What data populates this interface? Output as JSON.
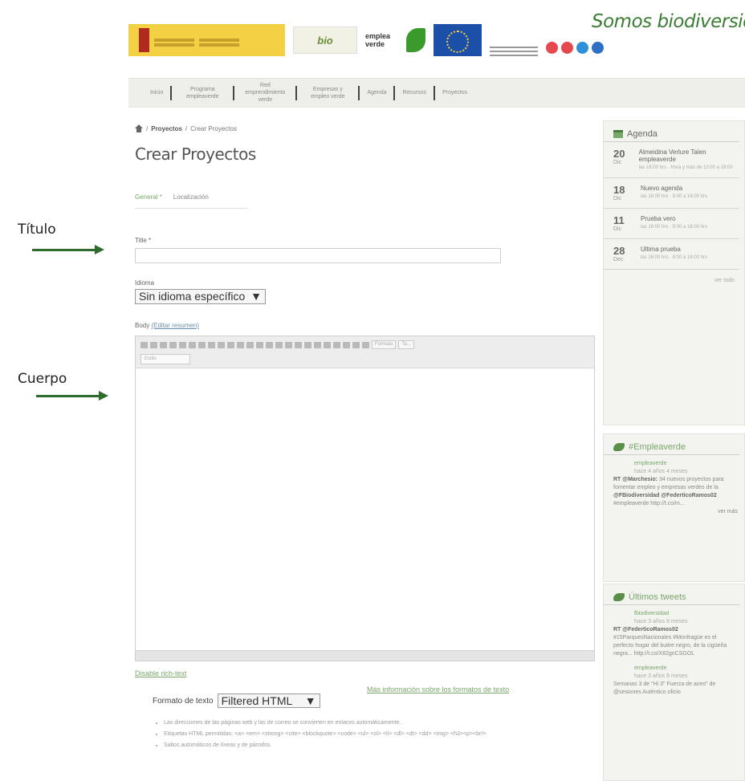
{
  "annotations": {
    "titulo": "Título",
    "cuerpo": "Cuerpo"
  },
  "header": {
    "brand_title": "Somos biodiversidad",
    "logos": {
      "ministry": "gobierno-ministerio-logo",
      "biodiversidad": "fundacion-biodiversidad-logo",
      "emplea_verde_text": "emplea verde",
      "eu": "union-europea-logo"
    },
    "social_colors": [
      "#e5484d",
      "#e5484d",
      "#2f8fd8",
      "#2f6fc4"
    ]
  },
  "nav": {
    "items": [
      "Inicio",
      "Programa empleaverde",
      "Red emprendimiento verde",
      "Empresas y empleo verde",
      "Agenda",
      "Recursos",
      "Proyectos"
    ]
  },
  "breadcrumb": {
    "parent": "Proyectos",
    "current": "Crear Proyectos"
  },
  "page": {
    "title": "Crear Proyectos",
    "tabs": [
      "General *",
      "Localización"
    ]
  },
  "form": {
    "title_label": "Title *",
    "title_value": "",
    "language_label": "Idioma",
    "language_value": "Sin idioma específico",
    "body_label": "Body",
    "edit_summary_link": "(Editar resumen)",
    "editor": {
      "format_dropdown": "Formato",
      "size_dropdown": "Ta...",
      "styles_dropdown": "Estilo"
    },
    "disable_rich_text": "Disable rich-text",
    "more_info_link": "Más información sobre los formatos de texto",
    "text_format_label": "Formato de texto",
    "text_format_value": "Filtered HTML",
    "format_tips": [
      "Las direcciones de las páginas web y las de correo se convierten en enlaces automáticamente.",
      "Etiquetas HTML permitidas: <a> <em> <strong> <cite> <blockquote> <code> <ul> <ol> <li> <dl> <dt> <dd> <img> <h3><p><br/>",
      "Saltos automáticos de líneas y de párrafos."
    ]
  },
  "sidebar": {
    "agenda": {
      "title": "Agenda",
      "events": [
        {
          "day": "20",
          "month": "Dic",
          "title": "Almeidina Verlure Talen empleaverde",
          "meta": "las 16:00 hrs · Hora y más de 10:00 a 18:00"
        },
        {
          "day": "18",
          "month": "Dic",
          "title": "Nuevo agenda",
          "meta": "las 16:00 hrs · 9:00 a 16:00 hrs"
        },
        {
          "day": "11",
          "month": "Dic",
          "title": "Prueba vero",
          "meta": "las 16:00 hrs · 9:00 a 16:00 hrs"
        },
        {
          "day": "28",
          "month": "Dec",
          "title": "Ultima prueba",
          "meta": "las 16:00 hrs · 9:00 a 16:00 hrs"
        }
      ],
      "see_more": "ver todo"
    },
    "hashtag": {
      "title": "#Empleaverde",
      "user": "empleaverde",
      "time": "hace 4 años 4 meses",
      "text_mentions": "RT @Marchesio:",
      "text_body": "34 nuevos proyectos para fomentar empleo y empresas verdes de la",
      "text_mentions2": "@FBiodiversidad @FederticoRamos02",
      "text_tail": "#empleaverde http://t.co/m...",
      "see_more": "ver más"
    },
    "tweets": {
      "title": "Últimos tweets",
      "t1_user": "fbiodiversidad",
      "t1_time": "hace 3 años 8 meses",
      "t1_mentions": "RT @FederticoRamos02",
      "t1_text": "#15ParquesNacionales #Monfragüe es el perfecto hogar del buitre negro, de la cigüeña negra... http://t.co/X82gnCSGOL",
      "t2_user": "empleaverde",
      "t2_time": "hace 3 años 8 meses",
      "t2_text": "Semanas 3 de \"Hi 3\" Fuerza de aceo\" de @sesiones Auténtico oficio"
    }
  }
}
